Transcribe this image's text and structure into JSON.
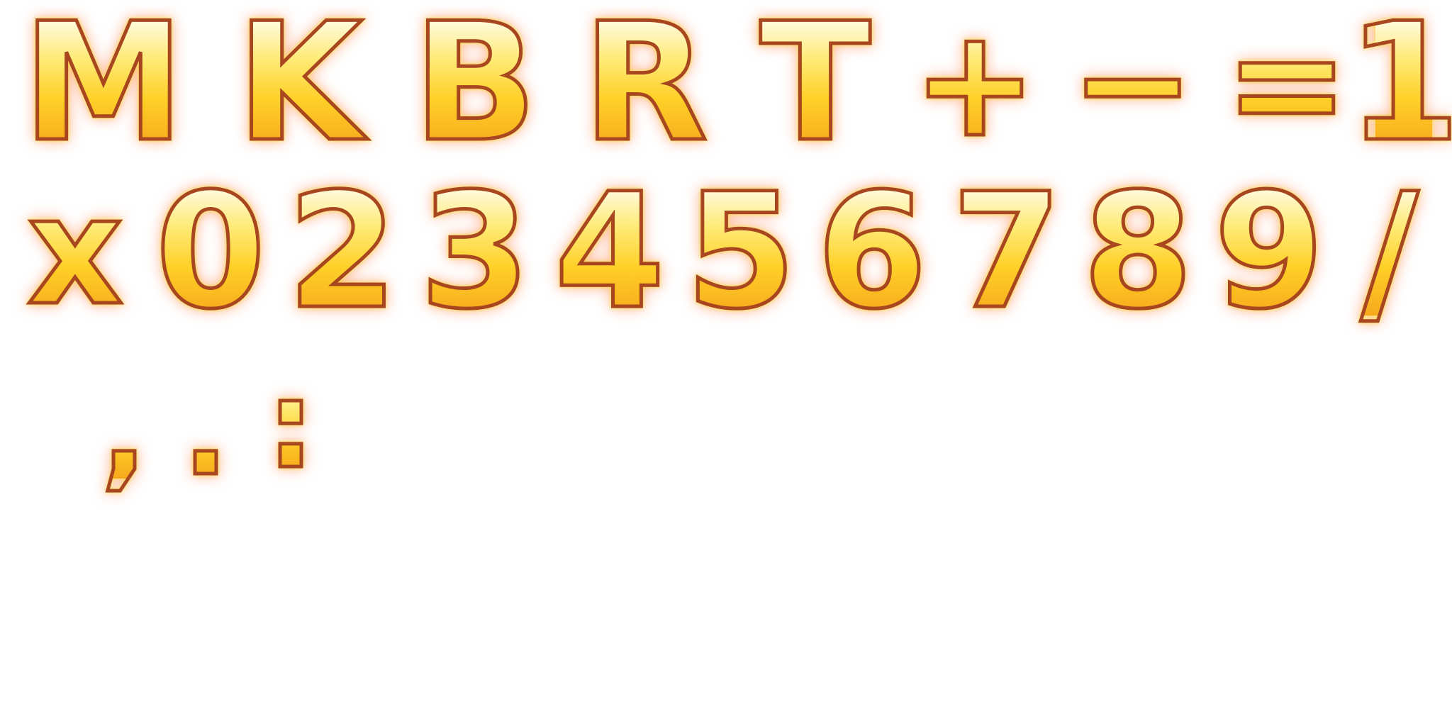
{
  "sprite_sheet": {
    "row1": [
      "M",
      "K",
      "B",
      "R",
      "T",
      "+",
      "−",
      "=",
      "1"
    ],
    "row2": [
      "x",
      "0",
      "2",
      "3",
      "4",
      "5",
      "6",
      "7",
      "8",
      "9",
      "/"
    ],
    "row3": [
      ",",
      ".",
      ":"
    ]
  },
  "colors": {
    "fill_top": "#fffbe0",
    "fill_mid": "#ffd028",
    "fill_bottom": "#f7a91c",
    "outline": "#a8471f",
    "glow": "#ff7a3c",
    "background": "#ffffff"
  }
}
